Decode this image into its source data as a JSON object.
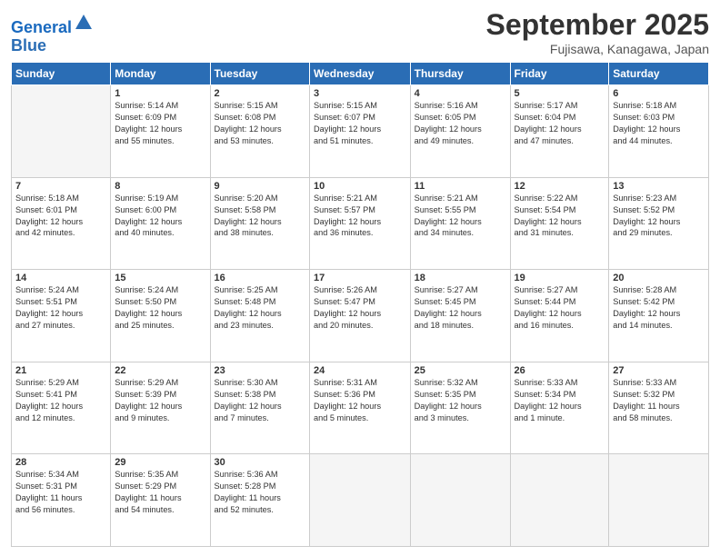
{
  "header": {
    "logo_line1": "General",
    "logo_line2": "Blue",
    "month": "September 2025",
    "location": "Fujisawa, Kanagawa, Japan"
  },
  "weekdays": [
    "Sunday",
    "Monday",
    "Tuesday",
    "Wednesday",
    "Thursday",
    "Friday",
    "Saturday"
  ],
  "weeks": [
    [
      {
        "num": "",
        "info": ""
      },
      {
        "num": "1",
        "info": "Sunrise: 5:14 AM\nSunset: 6:09 PM\nDaylight: 12 hours\nand 55 minutes."
      },
      {
        "num": "2",
        "info": "Sunrise: 5:15 AM\nSunset: 6:08 PM\nDaylight: 12 hours\nand 53 minutes."
      },
      {
        "num": "3",
        "info": "Sunrise: 5:15 AM\nSunset: 6:07 PM\nDaylight: 12 hours\nand 51 minutes."
      },
      {
        "num": "4",
        "info": "Sunrise: 5:16 AM\nSunset: 6:05 PM\nDaylight: 12 hours\nand 49 minutes."
      },
      {
        "num": "5",
        "info": "Sunrise: 5:17 AM\nSunset: 6:04 PM\nDaylight: 12 hours\nand 47 minutes."
      },
      {
        "num": "6",
        "info": "Sunrise: 5:18 AM\nSunset: 6:03 PM\nDaylight: 12 hours\nand 44 minutes."
      }
    ],
    [
      {
        "num": "7",
        "info": "Sunrise: 5:18 AM\nSunset: 6:01 PM\nDaylight: 12 hours\nand 42 minutes."
      },
      {
        "num": "8",
        "info": "Sunrise: 5:19 AM\nSunset: 6:00 PM\nDaylight: 12 hours\nand 40 minutes."
      },
      {
        "num": "9",
        "info": "Sunrise: 5:20 AM\nSunset: 5:58 PM\nDaylight: 12 hours\nand 38 minutes."
      },
      {
        "num": "10",
        "info": "Sunrise: 5:21 AM\nSunset: 5:57 PM\nDaylight: 12 hours\nand 36 minutes."
      },
      {
        "num": "11",
        "info": "Sunrise: 5:21 AM\nSunset: 5:55 PM\nDaylight: 12 hours\nand 34 minutes."
      },
      {
        "num": "12",
        "info": "Sunrise: 5:22 AM\nSunset: 5:54 PM\nDaylight: 12 hours\nand 31 minutes."
      },
      {
        "num": "13",
        "info": "Sunrise: 5:23 AM\nSunset: 5:52 PM\nDaylight: 12 hours\nand 29 minutes."
      }
    ],
    [
      {
        "num": "14",
        "info": "Sunrise: 5:24 AM\nSunset: 5:51 PM\nDaylight: 12 hours\nand 27 minutes."
      },
      {
        "num": "15",
        "info": "Sunrise: 5:24 AM\nSunset: 5:50 PM\nDaylight: 12 hours\nand 25 minutes."
      },
      {
        "num": "16",
        "info": "Sunrise: 5:25 AM\nSunset: 5:48 PM\nDaylight: 12 hours\nand 23 minutes."
      },
      {
        "num": "17",
        "info": "Sunrise: 5:26 AM\nSunset: 5:47 PM\nDaylight: 12 hours\nand 20 minutes."
      },
      {
        "num": "18",
        "info": "Sunrise: 5:27 AM\nSunset: 5:45 PM\nDaylight: 12 hours\nand 18 minutes."
      },
      {
        "num": "19",
        "info": "Sunrise: 5:27 AM\nSunset: 5:44 PM\nDaylight: 12 hours\nand 16 minutes."
      },
      {
        "num": "20",
        "info": "Sunrise: 5:28 AM\nSunset: 5:42 PM\nDaylight: 12 hours\nand 14 minutes."
      }
    ],
    [
      {
        "num": "21",
        "info": "Sunrise: 5:29 AM\nSunset: 5:41 PM\nDaylight: 12 hours\nand 12 minutes."
      },
      {
        "num": "22",
        "info": "Sunrise: 5:29 AM\nSunset: 5:39 PM\nDaylight: 12 hours\nand 9 minutes."
      },
      {
        "num": "23",
        "info": "Sunrise: 5:30 AM\nSunset: 5:38 PM\nDaylight: 12 hours\nand 7 minutes."
      },
      {
        "num": "24",
        "info": "Sunrise: 5:31 AM\nSunset: 5:36 PM\nDaylight: 12 hours\nand 5 minutes."
      },
      {
        "num": "25",
        "info": "Sunrise: 5:32 AM\nSunset: 5:35 PM\nDaylight: 12 hours\nand 3 minutes."
      },
      {
        "num": "26",
        "info": "Sunrise: 5:33 AM\nSunset: 5:34 PM\nDaylight: 12 hours\nand 1 minute."
      },
      {
        "num": "27",
        "info": "Sunrise: 5:33 AM\nSunset: 5:32 PM\nDaylight: 11 hours\nand 58 minutes."
      }
    ],
    [
      {
        "num": "28",
        "info": "Sunrise: 5:34 AM\nSunset: 5:31 PM\nDaylight: 11 hours\nand 56 minutes."
      },
      {
        "num": "29",
        "info": "Sunrise: 5:35 AM\nSunset: 5:29 PM\nDaylight: 11 hours\nand 54 minutes."
      },
      {
        "num": "30",
        "info": "Sunrise: 5:36 AM\nSunset: 5:28 PM\nDaylight: 11 hours\nand 52 minutes."
      },
      {
        "num": "",
        "info": ""
      },
      {
        "num": "",
        "info": ""
      },
      {
        "num": "",
        "info": ""
      },
      {
        "num": "",
        "info": ""
      }
    ]
  ]
}
